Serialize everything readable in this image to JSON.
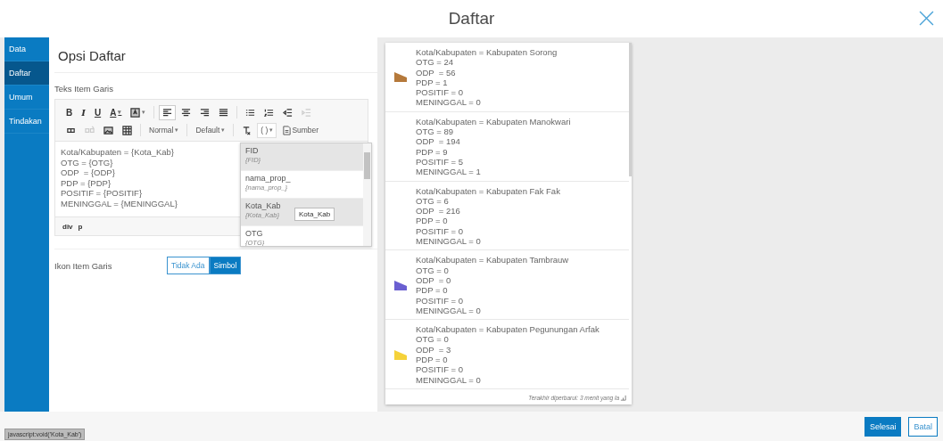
{
  "window": {
    "title": "Daftar"
  },
  "nav": [
    {
      "label": "Data",
      "selected": false
    },
    {
      "label": "Daftar",
      "selected": true
    },
    {
      "label": "Umum",
      "selected": false
    },
    {
      "label": "Tindakan",
      "selected": false
    }
  ],
  "panel_title": "Opsi Daftar",
  "editor": {
    "label": "Teks Item Garis",
    "toolbar_rows": [
      [
        {
          "kind": "glyph",
          "label": "B"
        },
        {
          "kind": "glyph",
          "label": "I"
        },
        {
          "kind": "glyph",
          "label": "U"
        },
        {
          "kind": "glyph",
          "label": "A",
          "caret": "▾"
        },
        {
          "kind": "icon",
          "caret": "▾"
        },
        {
          "kind": "sep"
        },
        {
          "kind": "icon",
          "selected": true
        },
        {
          "kind": "icon",
          "selected": false
        },
        {
          "kind": "icon",
          "selected": false
        },
        {
          "kind": "icon",
          "selected": false
        },
        {
          "kind": "sep"
        },
        {
          "kind": "icon",
          "disabled": false
        },
        {
          "kind": "icon",
          "disabled": false
        },
        {
          "kind": "icon",
          "disabled": false
        },
        {
          "kind": "icon",
          "disabled": true
        }
      ],
      [
        {
          "kind": "icon",
          "disabled": false
        },
        {
          "kind": "icon",
          "disabled": true
        },
        {
          "kind": "icon",
          "disabled": false
        },
        {
          "kind": "icon",
          "disabled": false
        },
        {
          "kind": "sep"
        },
        {
          "kind": "dropdown",
          "label": "Normal",
          "caret": "▾"
        },
        {
          "kind": "sep"
        },
        {
          "kind": "dropdown",
          "label": "Default",
          "caret": "▾"
        },
        {
          "kind": "sep"
        },
        {
          "kind": "icon",
          "disabled": false
        },
        {
          "kind": "dropdown",
          "label": "( )",
          "caret": "▾",
          "open": true
        },
        {
          "kind": "source",
          "label": "Sumber"
        }
      ]
    ],
    "lines": [
      "Kota/Kabupaten = {Kota_Kab}",
      "OTG = {OTG}",
      "ODP  = {ODP}",
      "PDP = {PDP}",
      "POSITIF = {POSITIF}",
      "MENINGGAL = {MENINGGAL}"
    ],
    "path": [
      "div",
      "p"
    ]
  },
  "field_menu": {
    "items": [
      {
        "name": "FID",
        "field": "{FID}",
        "highlighted": true
      },
      {
        "name": "nama_prop_",
        "field": "{nama_prop_}",
        "highlighted": false
      },
      {
        "name": "Kota_Kab",
        "field": "{Kota_Kab}",
        "highlighted": true
      },
      {
        "name": "OTG",
        "field": "{OTG}",
        "highlighted": false
      }
    ],
    "tooltip": "Kota_Kab"
  },
  "icon_option": {
    "label": "Ikon Item Garis",
    "choices": [
      {
        "label": "Tidak Ada",
        "selected": false
      },
      {
        "label": "Simbol",
        "selected": true
      }
    ]
  },
  "preview": {
    "items": [
      {
        "color": "#b5793b",
        "lines": [
          "Kota/Kabupaten = Kabupaten Sorong",
          "OTG = 24",
          "ODP  = 56",
          "PDP = 1",
          "POSITIF = 0",
          "MENINGGAL = 0"
        ]
      },
      {
        "lines": [
          "Kota/Kabupaten = Kabupaten Manokwari",
          "OTG = 89",
          "ODP  = 194",
          "PDP = 9",
          "POSITIF = 5",
          "MENINGGAL = 1"
        ]
      },
      {
        "lines": [
          "Kota/Kabupaten = Kabupaten Fak Fak",
          "OTG = 6",
          "ODP  = 216",
          "PDP = 0",
          "POSITIF = 0",
          "MENINGGAL = 0"
        ]
      },
      {
        "color": "#6a5fd1",
        "lines": [
          "Kota/Kabupaten = Kabupaten Tambrauw",
          "OTG = 0",
          "ODP  = 0",
          "PDP = 0",
          "POSITIF = 0",
          "MENINGGAL = 0"
        ]
      },
      {
        "color": "#f5d23a",
        "lines": [
          "Kota/Kabupaten = Kabupaten Pegunungan Arfak",
          "OTG = 0",
          "ODP  = 3",
          "PDP = 0",
          "POSITIF = 0",
          "MENINGGAL = 0"
        ]
      }
    ],
    "footer": "Terakhir diperbarui: 3 menit yang la"
  },
  "status_url": "javascript:void('Kota_Kab')",
  "buttons": [
    {
      "label": "Selesai",
      "kind": "primary"
    },
    {
      "label": "Batal",
      "kind": "secondary"
    }
  ]
}
